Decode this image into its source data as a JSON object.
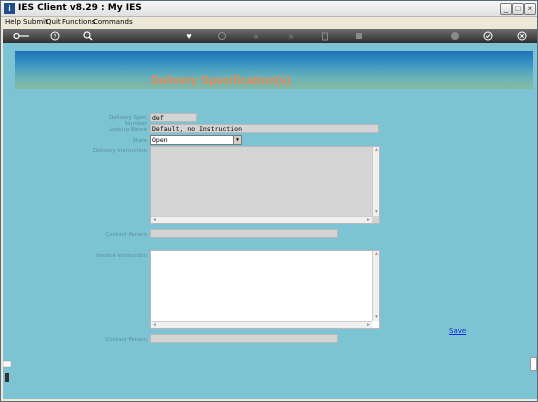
{
  "window": {
    "title": "IES Client v8.29 : My IES",
    "controls": {
      "minimize": "_",
      "maximize": "□",
      "close": "×"
    }
  },
  "menu": {
    "items": [
      {
        "label": "Help"
      },
      {
        "label": "Submit"
      },
      {
        "label": "Quit"
      },
      {
        "label": "Functions"
      },
      {
        "label": "Commands"
      }
    ]
  },
  "toolbar": {
    "icons": [
      "key-icon",
      "help-icon",
      "search-icon",
      "heart-icon",
      "refresh-icon",
      "rewind-icon",
      "fast-forward-icon",
      "trash-icon",
      "stop-icon",
      "globe-icon",
      "check-icon",
      "close-icon"
    ]
  },
  "banner": {
    "title": "Delivery Specification(s)",
    "colors": {
      "top": "#1f6fb5",
      "bottom": "#86b9a4",
      "title": "#e48a55"
    }
  },
  "form": {
    "delivery_spec_number": {
      "label": "Delivery Spec Number",
      "value": "def"
    },
    "lookup_name": {
      "label": "Lookup Name",
      "value": "Default, no Instruction"
    },
    "state": {
      "label": "State",
      "value": "Open"
    },
    "delivery_instruction": {
      "label": "Delivery Instruction",
      "value": ""
    },
    "contact_person_1": {
      "label": "Contact Person",
      "value": ""
    },
    "invoice_instruction": {
      "label": "Invoice Instruction",
      "value": ""
    },
    "contact_person_2": {
      "label": "Contact Person",
      "value": ""
    },
    "save_label": "Save"
  },
  "colors": {
    "content_bg": "#7cc4d4",
    "field_bg": "#d4d4d4",
    "link": "#1a2bd6"
  }
}
